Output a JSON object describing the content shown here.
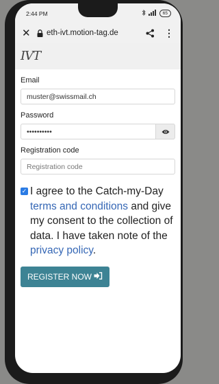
{
  "status": {
    "time": "2:44 PM",
    "battery": "65"
  },
  "browser": {
    "url": "eth-ivt.motion-tag.de"
  },
  "logo": {
    "text": "IVT"
  },
  "form": {
    "email_label": "Email",
    "email_value": "muster@swissmail.ch",
    "password_label": "Password",
    "password_value": "••••••••••",
    "registration_label": "Registration code",
    "registration_placeholder": "Registration code"
  },
  "consent": {
    "checked": true,
    "text_1": "I agree to the Catch-my-Day ",
    "terms_link": "terms and conditions",
    "text_2": " and give my consent to the collection of data. I have taken note of the ",
    "privacy_link": "privacy policy",
    "text_3": "."
  },
  "register_button": {
    "label": "REGISTER NOW"
  },
  "colors": {
    "accent": "#3d8394",
    "link": "#3567b5",
    "checkbox": "#2a7be4"
  }
}
